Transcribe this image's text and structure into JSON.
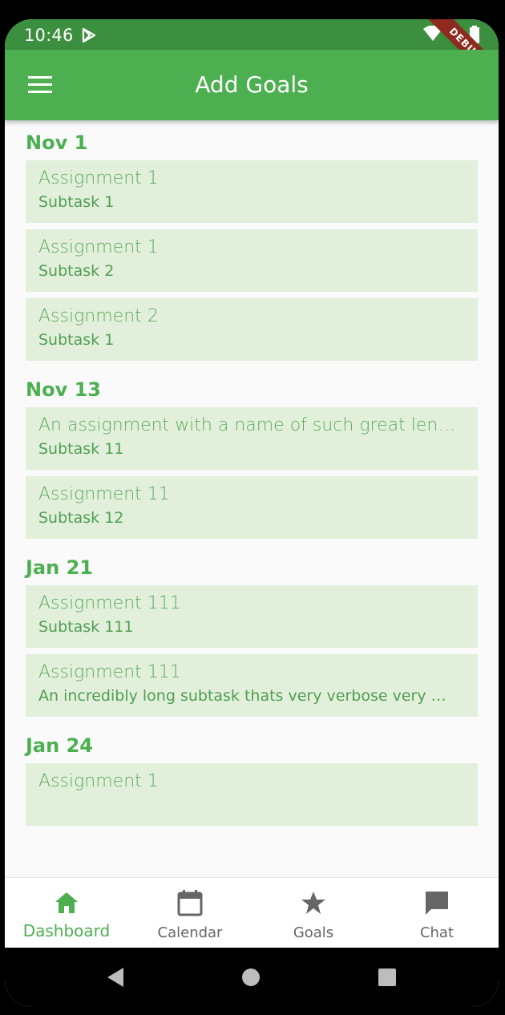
{
  "status": {
    "time": "10:46",
    "debug_banner": "DEBUG"
  },
  "appbar": {
    "title": "Add Goals",
    "menu_icon": "hamburger-menu-icon"
  },
  "groups": [
    {
      "date": "Nov 1",
      "items": [
        {
          "title": "Assignment 1",
          "subtask": "Subtask 1"
        },
        {
          "title": "Assignment 1",
          "subtask": "Subtask 2"
        },
        {
          "title": "Assignment 2",
          "subtask": "Subtask 1"
        }
      ]
    },
    {
      "date": "Nov 13",
      "items": [
        {
          "title": "An assignment with a name of such great lengt…",
          "subtask": "Subtask 11"
        },
        {
          "title": "Assignment 11",
          "subtask": "Subtask 12"
        }
      ]
    },
    {
      "date": "Jan 21",
      "items": [
        {
          "title": "Assignment 111",
          "subtask": "Subtask 111"
        },
        {
          "title": "Assignment 111",
          "subtask": "An incredibly long subtask thats very verbose very …"
        }
      ]
    },
    {
      "date": "Jan 24",
      "items": [
        {
          "title": "Assignment 1",
          "subtask": ""
        }
      ]
    }
  ],
  "bottom_nav": {
    "items": [
      {
        "label": "Dashboard",
        "icon": "home-icon",
        "active": true
      },
      {
        "label": "Calendar",
        "icon": "calendar-icon",
        "active": false
      },
      {
        "label": "Goals",
        "icon": "star-icon",
        "active": false
      },
      {
        "label": "Chat",
        "icon": "chat-icon",
        "active": false
      }
    ]
  },
  "colors": {
    "primary": "#4caf50",
    "status_bar": "#3c8f3f",
    "card_bg": "#e2f0db",
    "inactive_nav": "#666666"
  }
}
